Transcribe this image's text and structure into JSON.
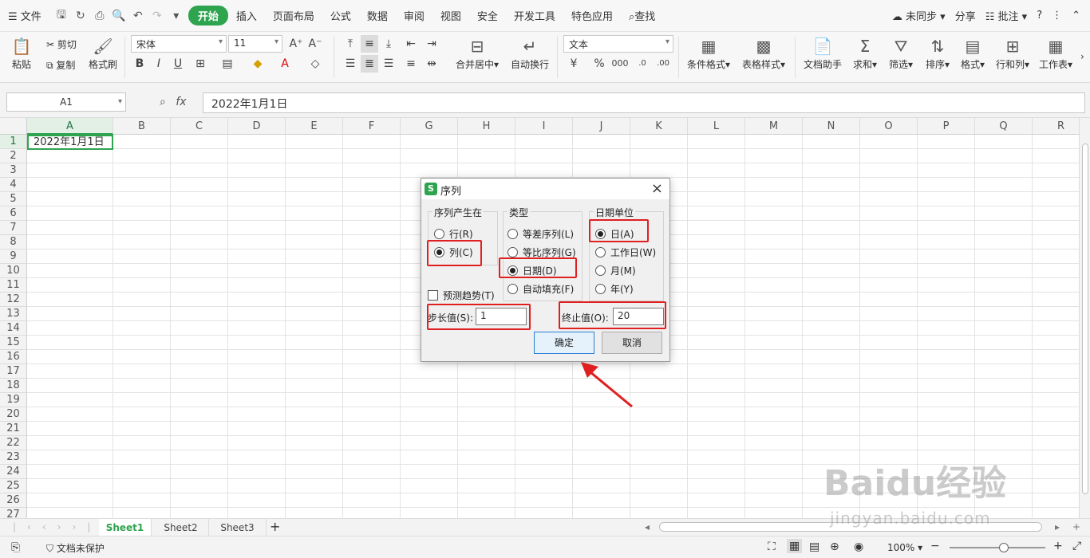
{
  "menubar": {
    "file": "文件",
    "tabs": [
      "开始",
      "插入",
      "页面布局",
      "公式",
      "数据",
      "审阅",
      "视图",
      "安全",
      "开发工具",
      "特色应用"
    ],
    "search": "查找",
    "sync": "未同步",
    "share": "分享",
    "comment": "批注"
  },
  "ribbon": {
    "paste": "粘贴",
    "cut": "剪切",
    "copy": "复制",
    "format_painter": "格式刷",
    "font_name": "宋体",
    "font_size": "11",
    "merge_center": "合并居中",
    "wrap": "自动换行",
    "number_format": "文本",
    "cond_format": "条件格式",
    "table_style": "表格样式",
    "doc_helper": "文档助手",
    "sum": "求和",
    "filter": "筛选",
    "sort": "排序",
    "format": "格式",
    "row_col": "行和列",
    "worksheet": "工作表"
  },
  "formula_bar": {
    "name_box": "A1",
    "formula": "2022年1月1日"
  },
  "grid": {
    "columns": [
      "A",
      "B",
      "C",
      "D",
      "E",
      "F",
      "G",
      "H",
      "I",
      "J",
      "K",
      "L",
      "M",
      "N",
      "O",
      "P",
      "Q",
      "R"
    ],
    "rows": [
      "1",
      "2",
      "3",
      "4",
      "5",
      "6",
      "7",
      "8",
      "9",
      "10",
      "11",
      "12",
      "13",
      "14",
      "15",
      "16",
      "17",
      "18",
      "19",
      "20",
      "21",
      "22",
      "23",
      "24",
      "25",
      "26",
      "27"
    ],
    "a1_value": "2022年1月1日"
  },
  "sheets": {
    "tabs": [
      "Sheet1",
      "Sheet2",
      "Sheet3"
    ],
    "add": "+"
  },
  "status": {
    "protect": "文档未保护",
    "zoom": "100%"
  },
  "dialog": {
    "title": "序列",
    "group_series_in": "序列产生在",
    "opt_row": "行(R)",
    "opt_col": "列(C)",
    "group_type": "类型",
    "opt_linear": "等差序列(L)",
    "opt_growth": "等比序列(G)",
    "opt_date": "日期(D)",
    "opt_autofill": "自动填充(F)",
    "group_date_unit": "日期单位",
    "opt_day": "日(A)",
    "opt_weekday": "工作日(W)",
    "opt_month": "月(M)",
    "opt_year": "年(Y)",
    "trend": "预测趋势(T)",
    "step_label": "步长值(S):",
    "step_value": "1",
    "stop_label": "终止值(O):",
    "stop_value": "20",
    "ok": "确定",
    "cancel": "取消"
  },
  "watermark": {
    "logo": "Baidu经验",
    "url": "jingyan.baidu.com"
  },
  "colors": {
    "accent": "#2ea44f",
    "highlight": "#e02020"
  }
}
